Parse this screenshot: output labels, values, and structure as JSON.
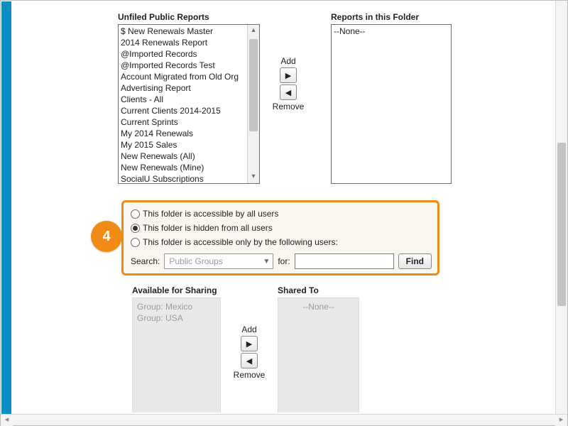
{
  "top": {
    "unfiled_label": "Unfiled Public Reports",
    "folder_label": "Reports in this Folder",
    "add_label": "Add",
    "remove_label": "Remove",
    "unfiled_reports": [
      "$ New Renewals Master",
      "2014 Renewals Report",
      "@Imported Records",
      "@Imported Records Test",
      "Account Migrated from Old Org",
      "Advertising Report",
      "Clients - All",
      "Current Clients 2014-2015",
      "Current Sprints",
      "My 2014 Renewals",
      "My 2015 Sales",
      "New Renewals (All)",
      "New Renewals (Mine)",
      "SocialU Subscriptions"
    ],
    "folder_empty_text": "--None--"
  },
  "access": {
    "callout_number": "4",
    "radio_all": "This folder is accessible by all users",
    "radio_hidden": "This folder is hidden from all users",
    "radio_following": "This folder is accessible only by the following users:",
    "selected_index": 1,
    "search_label": "Search:",
    "search_scope_selected": "Public Groups",
    "for_label": "for:",
    "search_value": "",
    "find_label": "Find"
  },
  "sharing": {
    "available_label": "Available for Sharing",
    "shared_label": "Shared To",
    "add_label": "Add",
    "remove_label": "Remove",
    "available_items": [
      "Group: Mexico",
      "Group: USA"
    ],
    "shared_empty_text": "--None--"
  }
}
